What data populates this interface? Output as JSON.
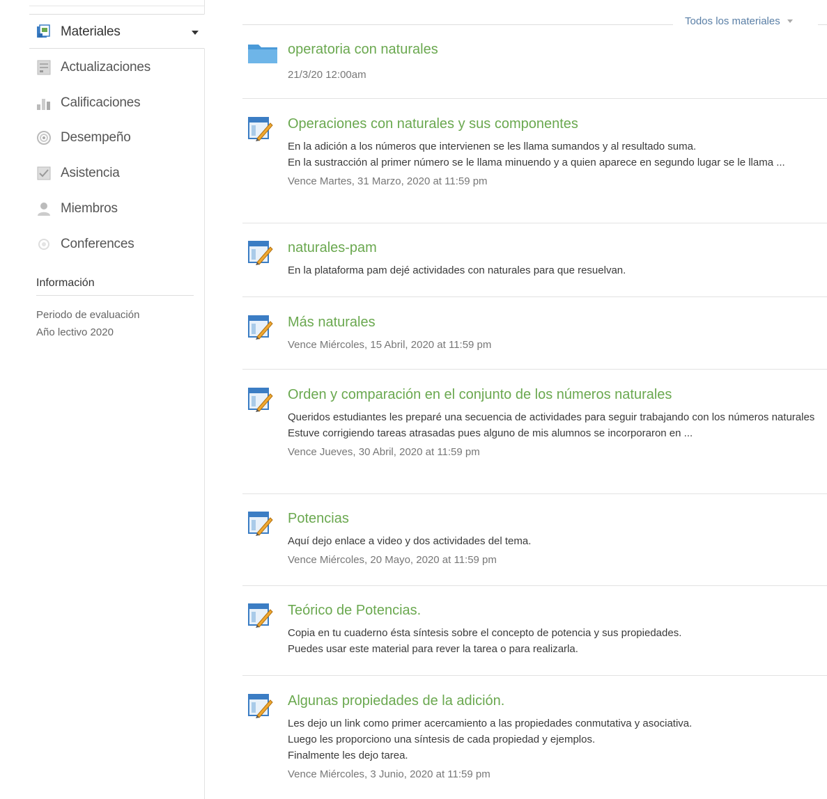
{
  "sidebar": {
    "items": [
      {
        "label": "Materiales",
        "icon": "materials-icon",
        "active": true
      },
      {
        "label": "Actualizaciones",
        "icon": "updates-icon"
      },
      {
        "label": "Calificaciones",
        "icon": "grades-icon"
      },
      {
        "label": "Desempeño",
        "icon": "performance-icon"
      },
      {
        "label": "Asistencia",
        "icon": "attendance-icon"
      },
      {
        "label": "Miembros",
        "icon": "members-icon"
      },
      {
        "label": "Conferences",
        "icon": "conferences-icon"
      }
    ],
    "info_title": "Información",
    "info_lines": [
      "Periodo de evaluación",
      "Año lectivo 2020"
    ]
  },
  "filter": {
    "label": "Todos los materiales"
  },
  "materials": [
    {
      "type": "folder",
      "icon": "folder-icon",
      "title": "operatoria con naturales",
      "lines": [],
      "due": "21/3/20 12:00am"
    },
    {
      "type": "assignment",
      "icon": "assignment-icon",
      "title": "Operaciones con naturales y sus componentes",
      "lines": [
        "En la adición a los números que intervienen se les llama sumandos y al resultado suma.",
        "En la sustracción al primer número se le llama minuendo y a quien aparece en segundo lugar se le llama ..."
      ],
      "due": "Vence Martes, 31 Marzo, 2020 at 11:59 pm"
    },
    {
      "type": "assignment",
      "icon": "assignment-icon",
      "title": "naturales-pam",
      "lines": [
        "En la plataforma pam dejé actividades con naturales para que resuelvan."
      ],
      "due": ""
    },
    {
      "type": "assignment",
      "icon": "assignment-icon",
      "title": "Más naturales",
      "lines": [],
      "due": "Vence Miércoles, 15 Abril, 2020 at 11:59 pm"
    },
    {
      "type": "assignment",
      "icon": "assignment-icon",
      "title": "Orden y comparación en el conjunto de los números naturales",
      "lines": [
        "Queridos estudiantes les preparé una secuencia de actividades para seguir trabajando con los números naturales",
        "Estuve corrigiendo tareas atrasadas pues alguno de mis alumnos se incorporaron en ..."
      ],
      "due": "Vence Jueves, 30 Abril, 2020 at 11:59 pm"
    },
    {
      "type": "assignment",
      "icon": "assignment-icon",
      "title": "Potencias",
      "lines": [
        "Aquí dejo enlace a video y dos actividades del tema."
      ],
      "due": "Vence Miércoles, 20 Mayo, 2020 at 11:59 pm"
    },
    {
      "type": "assignment",
      "icon": "assignment-icon",
      "title": "Teórico de Potencias.",
      "lines": [
        "Copia en tu cuaderno ésta síntesis sobre el concepto de potencia y sus propiedades.",
        "Puedes usar este material para rever la tarea o para realizarla."
      ],
      "due": ""
    },
    {
      "type": "assignment",
      "icon": "assignment-icon",
      "title": "Algunas propiedades de la adición.",
      "lines": [
        "Les dejo un link como primer acercamiento a las propiedades conmutativa y asociativa.",
        "Luego les proporciono una síntesis de cada propiedad y ejemplos.",
        "Finalmente les dejo tarea."
      ],
      "due": "Vence Miércoles, 3 Junio, 2020 at 11:59 pm"
    }
  ]
}
